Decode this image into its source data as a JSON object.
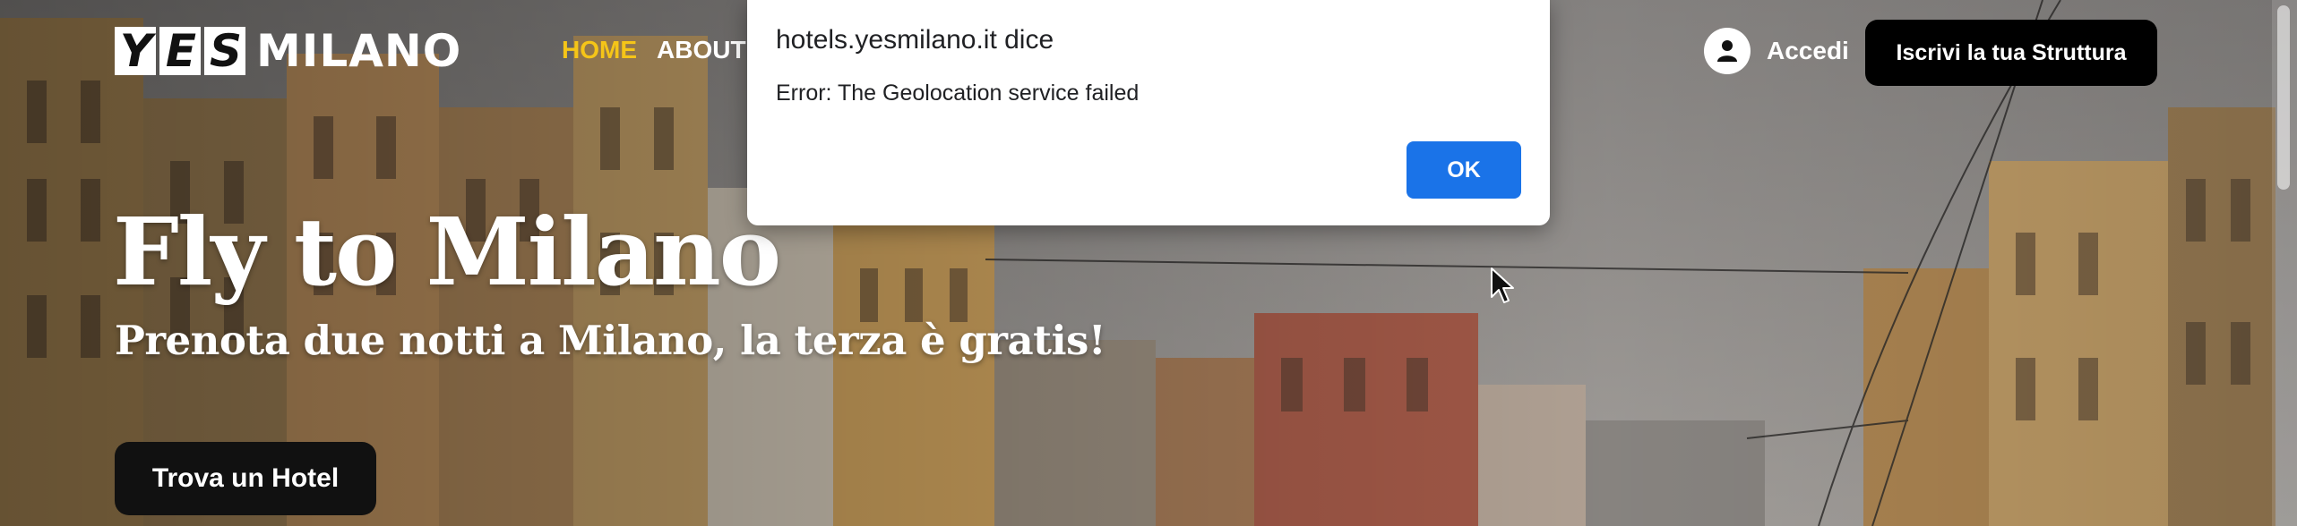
{
  "header": {
    "logo": {
      "box_letters": [
        "Y",
        "E",
        "S"
      ],
      "text": "MILANO"
    },
    "nav": [
      {
        "label": "HOME",
        "active": true
      },
      {
        "label": "ABOUT",
        "active": false
      }
    ],
    "login_label": "Accedi",
    "register_label": "Iscrivi la tua Struttura"
  },
  "hero": {
    "title": "Fly to Milano",
    "subtitle": "Prenota due notti a Milano, la terza è gratis!",
    "cta_label": "Trova un Hotel"
  },
  "alert": {
    "origin": "hotels.yesmilano.it dice",
    "message": "Error: The Geolocation service failed",
    "ok_label": "OK"
  },
  "colors": {
    "nav_active": "#f5c518",
    "ok_button": "#1a73e8",
    "cta_background": "#111111"
  },
  "icons": {
    "login": "user-circle-icon",
    "cursor": "mouse-pointer-icon"
  }
}
